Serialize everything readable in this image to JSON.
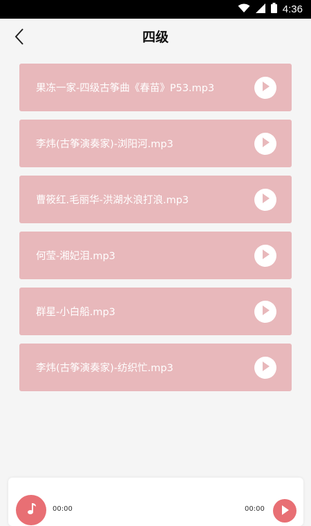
{
  "status_bar": {
    "time": "4:36",
    "icons": [
      "wifi-icon",
      "signal-icon",
      "battery-icon"
    ]
  },
  "header": {
    "title": "四级",
    "back_icon": "chevron-left-icon"
  },
  "tracks": [
    {
      "name": "果冻一家-四级古筝曲《春苗》P53.mp3"
    },
    {
      "name": "李炜(古筝演奏家)-浏阳河.mp3"
    },
    {
      "name": "曹筱红.毛丽华-洪湖水浪打浪.mp3"
    },
    {
      "name": "何莹-湘妃泪.mp3"
    },
    {
      "name": "群星-小白船.mp3"
    },
    {
      "name": "李炜(古筝演奏家)-纺织忙.mp3"
    }
  ],
  "player": {
    "current_time": "00:00",
    "total_time": "00:00",
    "avatar_icon": "music-note-icon",
    "play_icon": "play-icon"
  },
  "colors": {
    "item_background": "#e8b8bb",
    "accent": "#e86f74",
    "page_background": "#f5f5f5"
  }
}
